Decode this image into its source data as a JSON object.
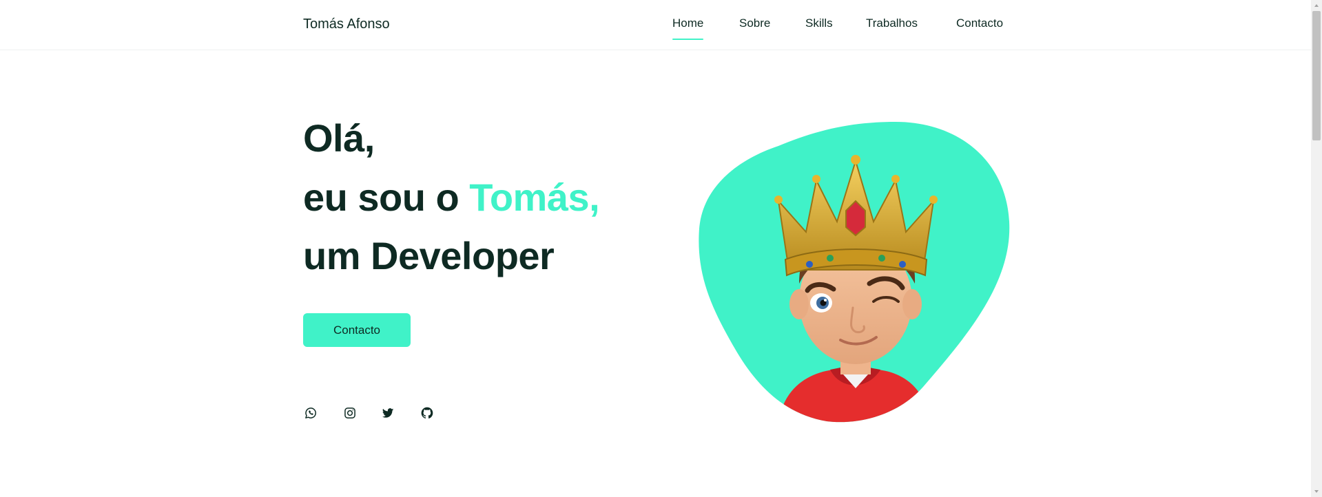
{
  "brand": {
    "name": "Tomás Afonso"
  },
  "nav": {
    "items": [
      {
        "label": "Home",
        "active": true
      },
      {
        "label": "Sobre",
        "active": false
      },
      {
        "label": "Skills",
        "active": false
      },
      {
        "label": "Trabalhos",
        "active": false
      },
      {
        "label": "Contacto",
        "active": false
      }
    ]
  },
  "hero": {
    "line1": "Olá,",
    "line2_prefix": "eu sou o ",
    "line2_highlight": "Tomás,",
    "line3": "um Developer",
    "cta_label": "Contacto"
  },
  "social": {
    "icons": [
      "whatsapp-icon",
      "instagram-icon",
      "twitter-icon",
      "github-icon"
    ]
  },
  "colors": {
    "accent": "#40f2c8",
    "text": "#0e2a23",
    "background": "#ffffff"
  }
}
